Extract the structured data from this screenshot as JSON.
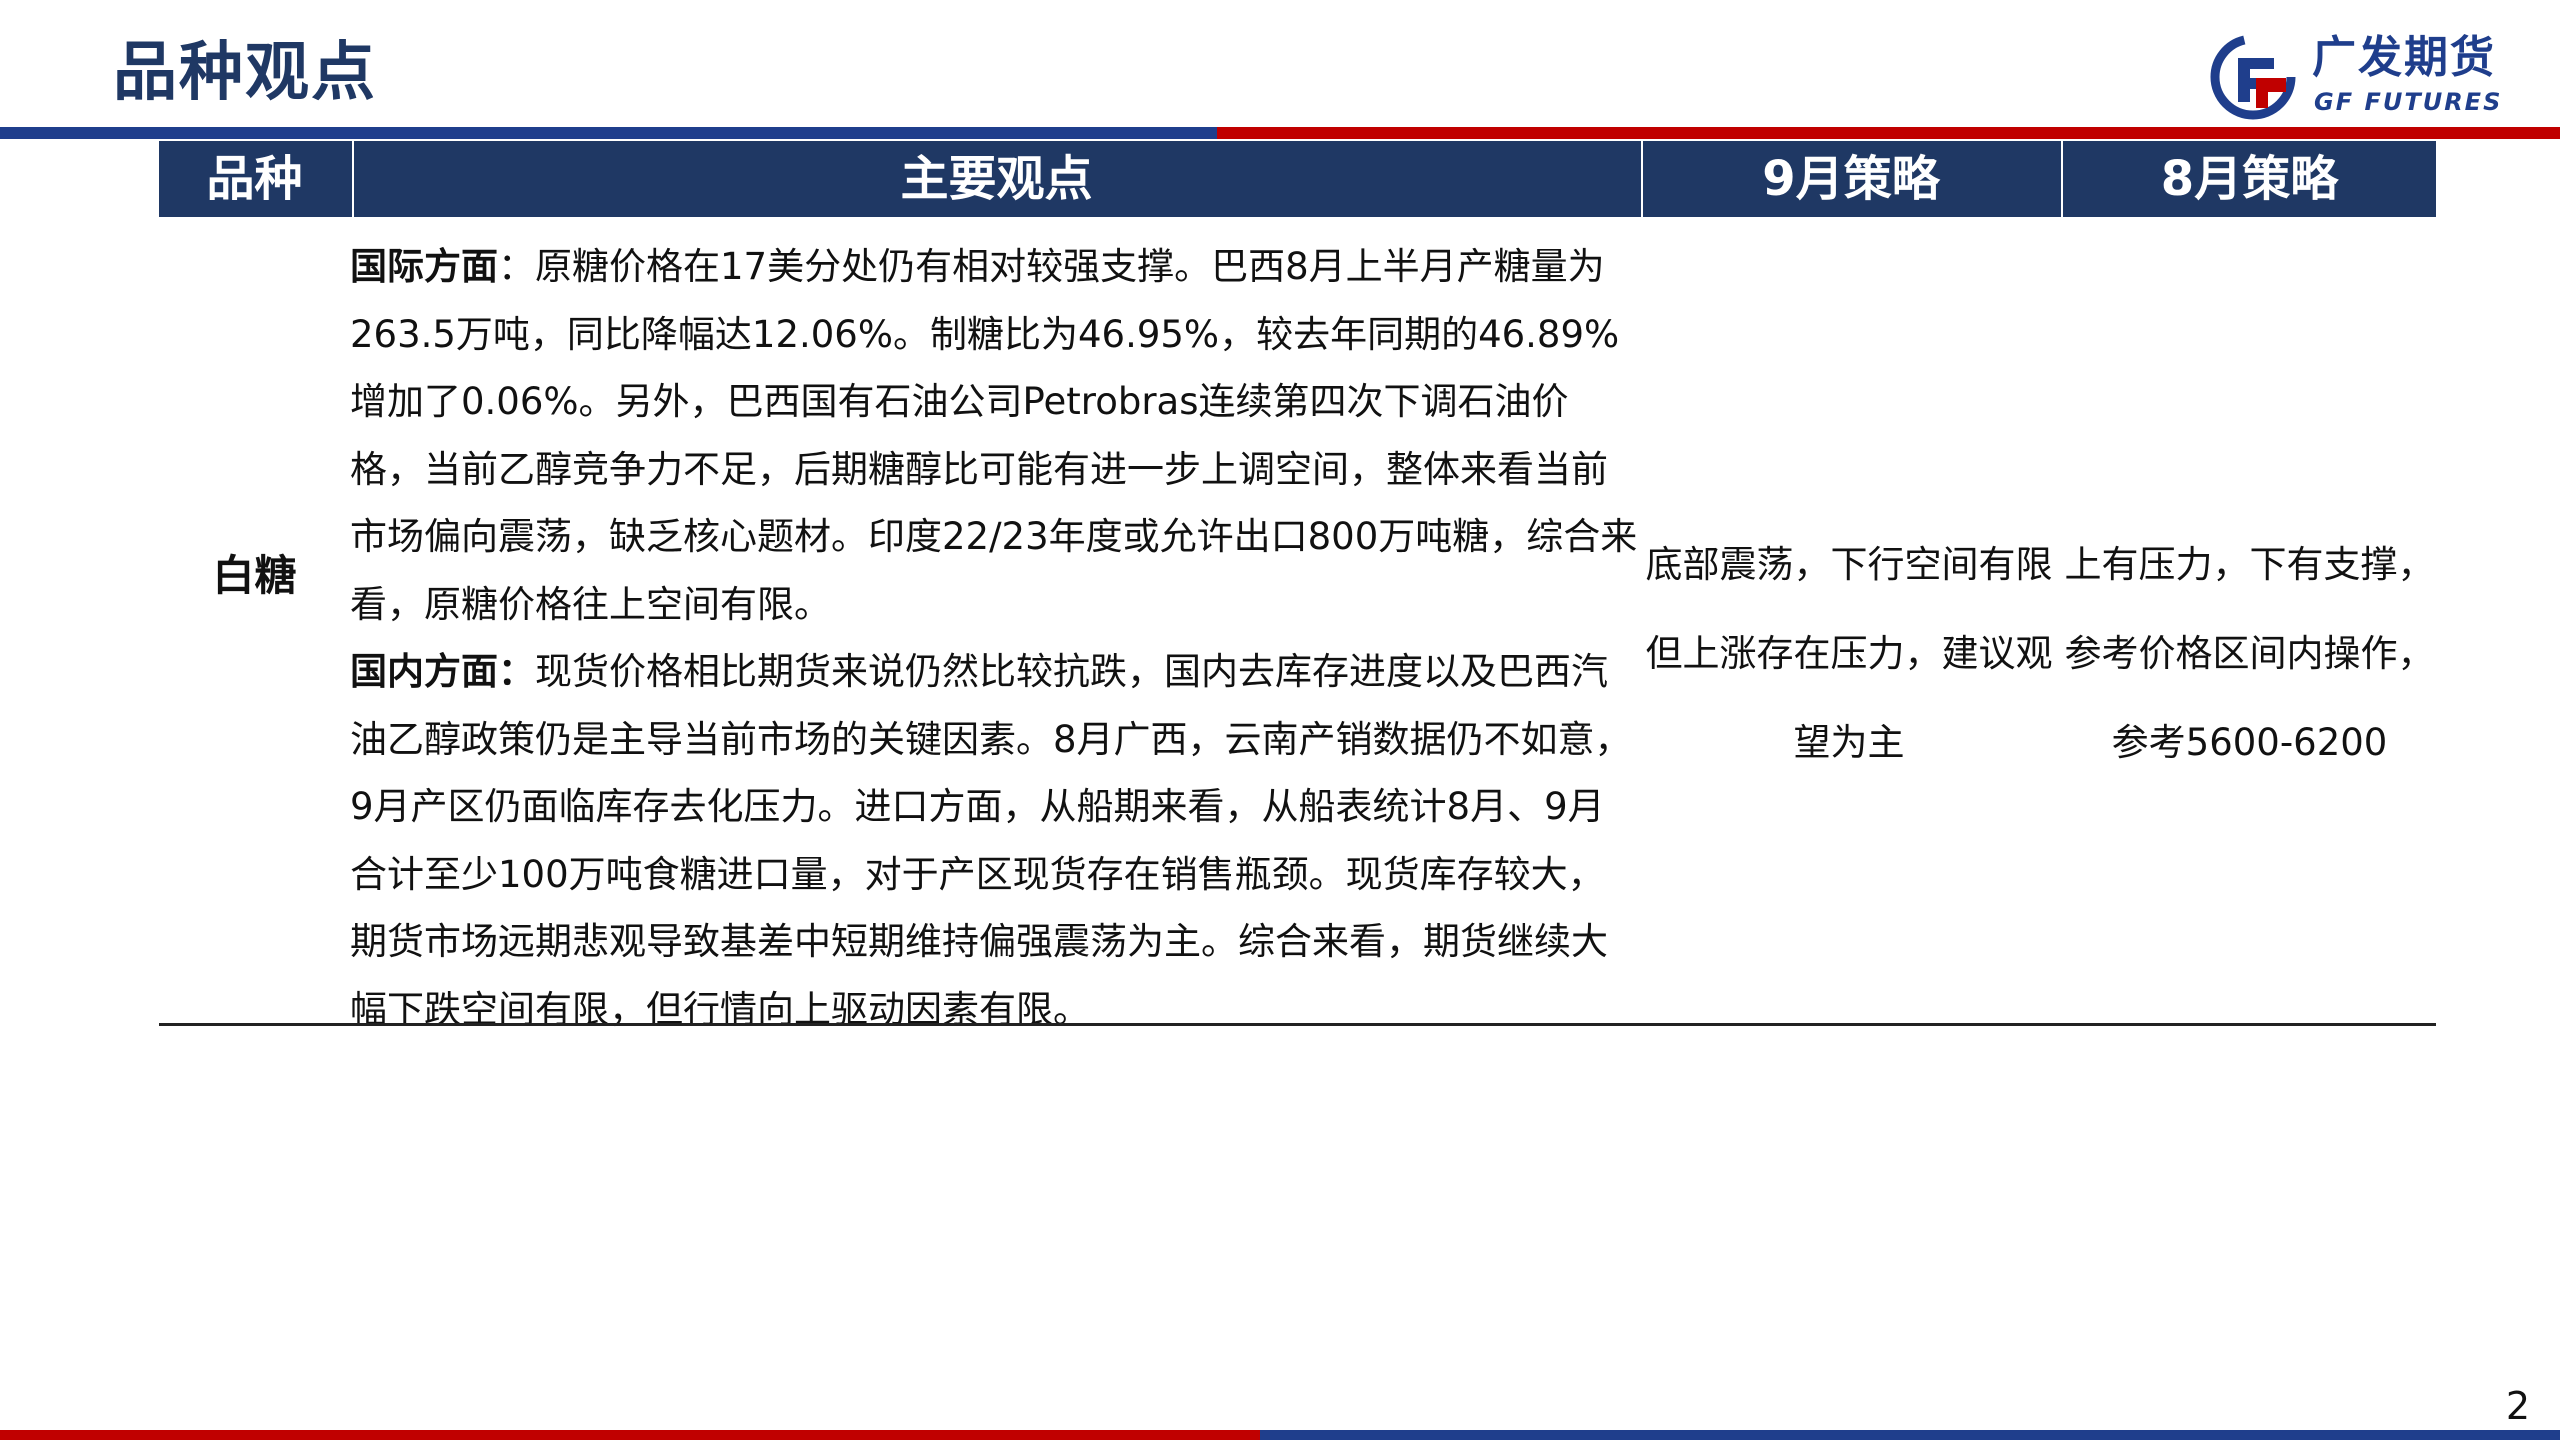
{
  "page": {
    "title": "品种观点",
    "page_number": "2"
  },
  "logo": {
    "cn": "广发期货",
    "en": "GF FUTURES",
    "icon": "gf-futures-logo-icon"
  },
  "colors": {
    "title": "#1f3864",
    "header_bg": "#1f3864",
    "brand_blue": "#1f3e8c",
    "brand_red": "#c00000"
  },
  "table": {
    "headers": [
      "品种",
      "主要观点",
      "9月策略",
      "8月策略"
    ],
    "row": {
      "variety": "白糖",
      "international_label": "国际方面",
      "international_sep": "：",
      "international_text": "原糖价格在17美分处仍有相对较强支撑。巴西8月上半月产糖量为263.5万吨，同比降幅达12.06%。制糖比为46.95%，较去年同期的46.89%增加了0.06%。另外，巴西国有石油公司Petrobras连续第四次下调石油价格，当前乙醇竞争力不足，后期糖醇比可能有进一步上调空间，整体来看当前市场偏向震荡，缺乏核心题材。印度22/23年度或允许出口800万吨糖，综合来看，原糖价格往上空间有限。",
      "domestic_label": "国内方面：",
      "domestic_text": "现货价格相比期货来说仍然比较抗跌，国内去库存进度以及巴西汽油乙醇政策仍是主导当前市场的关键因素。8月广西，云南产销数据仍不如意，9月产区仍面临库存去化压力。进口方面，从船期来看，从船表统计8月、9月合计至少100万吨食糖进口量，对于产区现货存在销售瓶颈。现货库存较大，期货市场远期悲观导致基差中短期维持偏强震荡为主。综合来看，期货继续大幅下跌空间有限，但行情向上驱动因素有限。",
      "sep_strategy": "底部震荡，下行空间有限但上涨存在压力，建议观望为主",
      "aug_strategy": "上有压力，下有支撑，参考价格区间内操作，参考5600-6200"
    }
  }
}
